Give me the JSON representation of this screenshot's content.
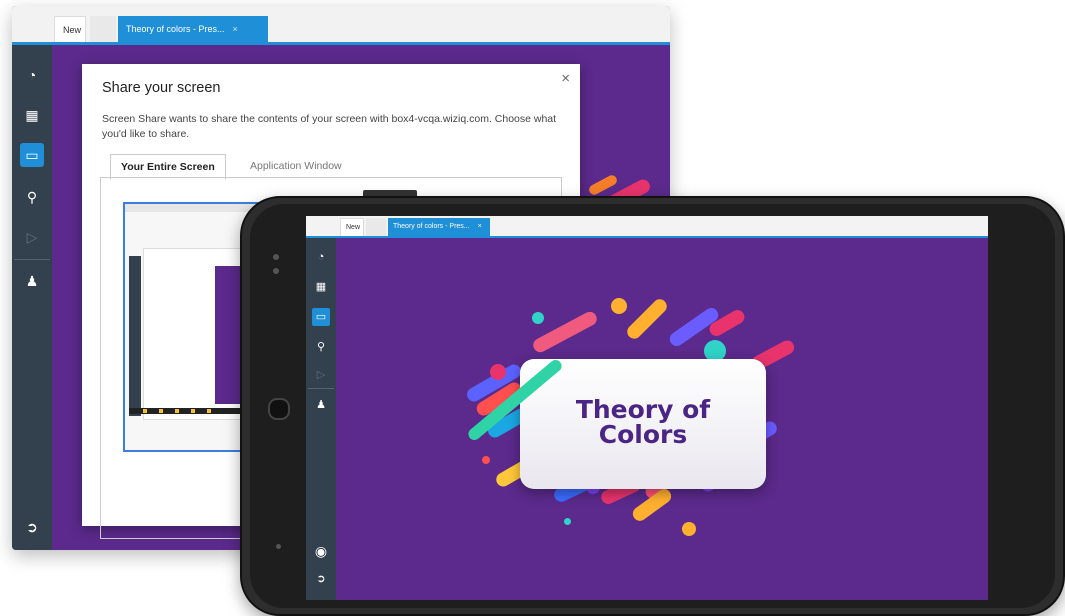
{
  "desktop": {
    "tabs": [
      {
        "label": "New"
      },
      {
        "label": ""
      },
      {
        "label": "Theory of colors - Pres...",
        "close": "×"
      }
    ],
    "sidebar_icons": [
      "chart-pie-icon",
      "bar-chart-icon",
      "screen-share-icon",
      "chat-icon",
      "video-icon",
      "participants-icon",
      "logout-icon"
    ]
  },
  "share_dialog": {
    "title": "Share your screen",
    "close": "×",
    "message": "Screen Share wants to share the contents of your screen with box4-vcqa.wiziq.com. Choose what you'd like to share.",
    "tabs": [
      "Your Entire Screen",
      "Application Window"
    ],
    "selected_tab": "Your Entire Screen"
  },
  "phone": {
    "tabs": [
      {
        "label": "New"
      },
      {
        "label": ""
      },
      {
        "label": "Theory of colors - Pres...",
        "close": "×"
      }
    ],
    "sidebar_icons": [
      "chart-pie-icon",
      "bar-chart-icon",
      "screen-share-icon",
      "chat-icon",
      "video-icon",
      "participants-icon",
      "user-avatar-icon",
      "logout-icon"
    ],
    "slide": {
      "title_line1": "Theory of",
      "title_line2": "Colors"
    }
  },
  "colors": {
    "purple_bg": "#5b2a8c",
    "sidebar": "#33414e",
    "accent_blue": "#1f8fd8",
    "slide_text": "#4b2585"
  }
}
